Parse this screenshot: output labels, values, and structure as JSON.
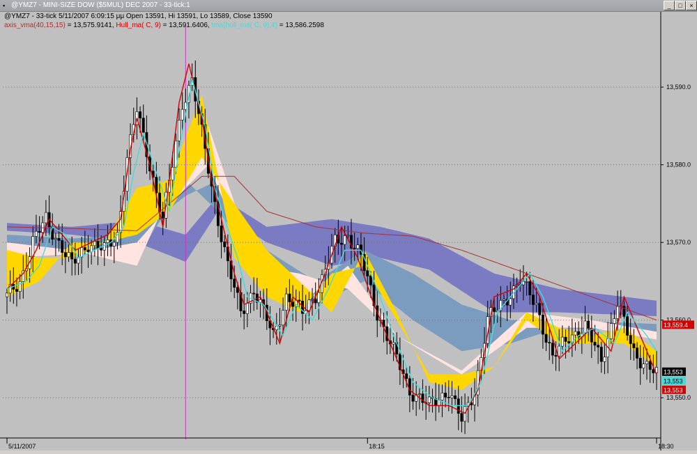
{
  "window": {
    "title": "@YMZ7 - MINI-SIZE DOW ($5MUL) DEC 2007 - 33-tick:1",
    "minimize_glyph": "_",
    "maximize_glyph": "□",
    "close_glyph": "×"
  },
  "info": {
    "line1": "@YMZ7 - 33-tick 5/11/2007 6:09:15 μμ Open 13591, Hi 13591, Lo 13589, Close 13590",
    "vma_label": "axis_vma(40,15,15)",
    "vma_value": "= 13,575.9141,",
    "hull_label": "Hull_ma( C, 9)",
    "hull_value": "= 13,591.6406,",
    "third_label": "tma(hull_ma( C, 9),4)",
    "third_value": "= 13,586.2598"
  },
  "colors": {
    "background": "#c0c0c0",
    "grid": "#707070",
    "gold": "#ffd700",
    "pink": "#ffe4e1",
    "steel": "#7c9cbf",
    "slate": "#7b7bc4",
    "hull": "#d40000",
    "trigger": "#3fdcdc",
    "vma": "#a83030",
    "cursor": "#cc33cc",
    "up_candle": "#ffffff",
    "down_candle": "#000000"
  },
  "chart_data": {
    "type": "candlestick",
    "ylim": [
      13545,
      13597
    ],
    "yticks": [
      13550,
      13560,
      13570,
      13580,
      13590
    ],
    "ytick_labels": [
      "13,550.0",
      "13,560.0",
      "13,570.0",
      "13,580.0",
      "13,590.0"
    ],
    "xtick_labels": [
      {
        "label": "5/11/2007",
        "index": 0
      },
      {
        "label": "18:15",
        "index": 111
      },
      {
        "label": "18:30",
        "index": 200
      }
    ],
    "price_tags": [
      {
        "label": "13,559.4",
        "value": 13559.4,
        "bg": "#d40000",
        "fg": "#ffffff"
      },
      {
        "label": "13,553",
        "value": 13553,
        "bg": "#000000",
        "fg": "#ffffff"
      },
      {
        "label": "13,553",
        "value": 13553,
        "bg": "#3fdcdc",
        "fg": "#000000"
      },
      {
        "label": "13,553",
        "value": 13553,
        "bg": "#d40000",
        "fg": "#ffffff"
      }
    ],
    "cursor_index": 55,
    "series": [
      {
        "name": "axis_vma(40,15,15)",
        "anchors": [
          [
            0,
            13572
          ],
          [
            20,
            13571.8
          ],
          [
            40,
            13571.5
          ],
          [
            50,
            13575
          ],
          [
            60,
            13578.5
          ],
          [
            70,
            13578.5
          ],
          [
            80,
            13574
          ],
          [
            95,
            13572
          ],
          [
            110,
            13571.2
          ],
          [
            125,
            13570.8
          ],
          [
            140,
            13569
          ],
          [
            160,
            13566
          ],
          [
            180,
            13563
          ],
          [
            200,
            13560
          ]
        ]
      },
      {
        "name": "Hull_ma( C, 9)",
        "anchors": [
          [
            0,
            13564
          ],
          [
            5,
            13566
          ],
          [
            9,
            13569
          ],
          [
            13,
            13573
          ],
          [
            17,
            13571
          ],
          [
            21,
            13569
          ],
          [
            26,
            13570
          ],
          [
            31,
            13571
          ],
          [
            35,
            13573
          ],
          [
            38,
            13582
          ],
          [
            40,
            13586
          ],
          [
            44,
            13580
          ],
          [
            48,
            13572
          ],
          [
            50,
            13578
          ],
          [
            53,
            13588
          ],
          [
            56,
            13593
          ],
          [
            60,
            13586
          ],
          [
            63,
            13578
          ],
          [
            66,
            13573
          ],
          [
            70,
            13566
          ],
          [
            73,
            13562
          ],
          [
            78,
            13563
          ],
          [
            84,
            13557
          ],
          [
            88,
            13563
          ],
          [
            93,
            13561
          ],
          [
            98,
            13566
          ],
          [
            103,
            13572
          ],
          [
            108,
            13568
          ],
          [
            113,
            13562
          ],
          [
            118,
            13557
          ],
          [
            124,
            13551
          ],
          [
            130,
            13549
          ],
          [
            136,
            13549
          ],
          [
            141,
            13548
          ],
          [
            145,
            13551
          ],
          [
            150,
            13563
          ],
          [
            156,
            13564
          ],
          [
            160,
            13566
          ],
          [
            164,
            13563
          ],
          [
            170,
            13555
          ],
          [
            175,
            13557
          ],
          [
            180,
            13559
          ],
          [
            186,
            13556
          ],
          [
            190,
            13563
          ],
          [
            196,
            13557
          ],
          [
            200,
            13553
          ]
        ]
      },
      {
        "name": "tma(hull_ma( C, 9),4)",
        "anchors": [
          [
            0,
            13564
          ],
          [
            6,
            13565
          ],
          [
            10,
            13567
          ],
          [
            14,
            13572
          ],
          [
            18,
            13571
          ],
          [
            22,
            13568
          ],
          [
            27,
            13569
          ],
          [
            32,
            13570
          ],
          [
            36,
            13572
          ],
          [
            39,
            13579
          ],
          [
            42,
            13584
          ],
          [
            46,
            13579
          ],
          [
            50,
            13574
          ],
          [
            53,
            13582
          ],
          [
            57,
            13591
          ],
          [
            61,
            13585
          ],
          [
            64,
            13577
          ],
          [
            67,
            13573
          ],
          [
            71,
            13568
          ],
          [
            74,
            13563
          ],
          [
            79,
            13562
          ],
          [
            85,
            13558
          ],
          [
            89,
            13562
          ],
          [
            94,
            13560
          ],
          [
            99,
            13564
          ],
          [
            104,
            13569
          ],
          [
            109,
            13569
          ],
          [
            114,
            13564
          ],
          [
            119,
            13558
          ],
          [
            125,
            13552
          ],
          [
            131,
            13550
          ],
          [
            137,
            13549
          ],
          [
            142,
            13549
          ],
          [
            146,
            13552
          ],
          [
            151,
            13561
          ],
          [
            157,
            13564
          ],
          [
            161,
            13566
          ],
          [
            165,
            13563
          ],
          [
            171,
            13556
          ],
          [
            176,
            13558
          ],
          [
            181,
            13559
          ],
          [
            187,
            13557
          ],
          [
            191,
            13561
          ],
          [
            197,
            13558
          ],
          [
            200,
            13556
          ]
        ]
      }
    ],
    "ribbons": [
      {
        "name": "slate",
        "color": "#7b7bc4",
        "upper": [
          [
            0,
            13572.5
          ],
          [
            20,
            13572
          ],
          [
            40,
            13572.8
          ],
          [
            55,
            13571
          ],
          [
            65,
            13576
          ],
          [
            80,
            13572
          ],
          [
            100,
            13573
          ],
          [
            115,
            13572
          ],
          [
            130,
            13570.5
          ],
          [
            150,
            13566
          ],
          [
            170,
            13564
          ],
          [
            200,
            13562.5
          ]
        ],
        "lower": [
          [
            0,
            13571.5
          ],
          [
            20,
            13571
          ],
          [
            40,
            13570
          ],
          [
            55,
            13567.5
          ],
          [
            65,
            13574
          ],
          [
            80,
            13570
          ],
          [
            100,
            13567
          ],
          [
            115,
            13568
          ],
          [
            130,
            13566.5
          ],
          [
            150,
            13561
          ],
          [
            170,
            13561
          ],
          [
            200,
            13560.5
          ]
        ]
      },
      {
        "name": "steel",
        "color": "#7c9cbf",
        "upper": [
          [
            0,
            13571
          ],
          [
            20,
            13570.5
          ],
          [
            40,
            13571
          ],
          [
            55,
            13576
          ],
          [
            65,
            13578
          ],
          [
            80,
            13569
          ],
          [
            95,
            13565
          ],
          [
            110,
            13569
          ],
          [
            125,
            13566
          ],
          [
            140,
            13562
          ],
          [
            155,
            13560
          ],
          [
            170,
            13560
          ],
          [
            200,
            13559.5
          ]
        ],
        "lower": [
          [
            0,
            13568
          ],
          [
            20,
            13569
          ],
          [
            40,
            13568
          ],
          [
            55,
            13578
          ],
          [
            65,
            13574
          ],
          [
            80,
            13566
          ],
          [
            95,
            13562
          ],
          [
            110,
            13565
          ],
          [
            125,
            13560
          ],
          [
            140,
            13556
          ],
          [
            155,
            13557
          ],
          [
            170,
            13559
          ],
          [
            200,
            13558.5
          ]
        ]
      },
      {
        "name": "pink",
        "color": "#ffe4e1",
        "upper": [
          [
            0,
            13570
          ],
          [
            20,
            13569
          ],
          [
            40,
            13567
          ],
          [
            55,
            13581
          ],
          [
            62,
            13585
          ],
          [
            75,
            13569
          ],
          [
            90,
            13562
          ],
          [
            105,
            13567
          ],
          [
            120,
            13558
          ],
          [
            140,
            13553.5
          ],
          [
            160,
            13561
          ],
          [
            180,
            13560
          ],
          [
            200,
            13558.5
          ]
        ],
        "lower": [
          [
            0,
            13568
          ],
          [
            20,
            13568.5
          ],
          [
            40,
            13570
          ],
          [
            55,
            13577
          ],
          [
            62,
            13580
          ],
          [
            75,
            13567
          ],
          [
            90,
            13566
          ],
          [
            105,
            13564
          ],
          [
            120,
            13558
          ],
          [
            140,
            13553
          ],
          [
            160,
            13559
          ],
          [
            180,
            13559
          ],
          [
            200,
            13557.5
          ]
        ]
      },
      {
        "name": "gold",
        "color": "#ffd700",
        "upper": [
          [
            0,
            13569
          ],
          [
            10,
            13568
          ],
          [
            20,
            13568
          ],
          [
            30,
            13570
          ],
          [
            40,
            13577
          ],
          [
            50,
            13578
          ],
          [
            60,
            13589
          ],
          [
            70,
            13568
          ],
          [
            80,
            13563
          ],
          [
            90,
            13561
          ],
          [
            100,
            13566
          ],
          [
            110,
            13567
          ],
          [
            120,
            13560
          ],
          [
            130,
            13553
          ],
          [
            140,
            13553
          ],
          [
            150,
            13554
          ],
          [
            160,
            13561
          ],
          [
            170,
            13559
          ],
          [
            180,
            13558
          ],
          [
            190,
            13559
          ],
          [
            200,
            13556
          ]
        ],
        "lower": [
          [
            0,
            13563
          ],
          [
            10,
            13565
          ],
          [
            20,
            13570
          ],
          [
            30,
            13570
          ],
          [
            40,
            13571
          ],
          [
            50,
            13574
          ],
          [
            60,
            13581
          ],
          [
            70,
            13575
          ],
          [
            80,
            13569
          ],
          [
            90,
            13565
          ],
          [
            100,
            13561
          ],
          [
            110,
            13569
          ],
          [
            120,
            13561
          ],
          [
            130,
            13552
          ],
          [
            140,
            13551
          ],
          [
            150,
            13554
          ],
          [
            160,
            13560
          ],
          [
            170,
            13557
          ],
          [
            180,
            13557
          ],
          [
            190,
            13557
          ],
          [
            200,
            13554
          ]
        ]
      }
    ],
    "price_path": [
      [
        0,
        13563
      ],
      [
        4,
        13565
      ],
      [
        8,
        13570
      ],
      [
        12,
        13573
      ],
      [
        16,
        13570
      ],
      [
        20,
        13567
      ],
      [
        25,
        13570
      ],
      [
        30,
        13569
      ],
      [
        34,
        13571
      ],
      [
        37,
        13581
      ],
      [
        40,
        13587
      ],
      [
        44,
        13580
      ],
      [
        48,
        13573
      ],
      [
        51,
        13580
      ],
      [
        54,
        13588
      ],
      [
        57,
        13591
      ],
      [
        60,
        13584
      ],
      [
        64,
        13575
      ],
      [
        68,
        13567
      ],
      [
        72,
        13561
      ],
      [
        76,
        13564
      ],
      [
        82,
        13558
      ],
      [
        86,
        13563
      ],
      [
        91,
        13561
      ],
      [
        96,
        13564
      ],
      [
        101,
        13570
      ],
      [
        105,
        13571
      ],
      [
        109,
        13568
      ],
      [
        114,
        13561
      ],
      [
        119,
        13556
      ],
      [
        124,
        13551
      ],
      [
        130,
        13549
      ],
      [
        136,
        13551
      ],
      [
        140,
        13547
      ],
      [
        144,
        13551
      ],
      [
        148,
        13560
      ],
      [
        154,
        13563
      ],
      [
        158,
        13565
      ],
      [
        163,
        13562
      ],
      [
        168,
        13555
      ],
      [
        173,
        13558
      ],
      [
        178,
        13559
      ],
      [
        183,
        13555
      ],
      [
        188,
        13562
      ],
      [
        193,
        13556
      ],
      [
        197,
        13554
      ],
      [
        200,
        13553
      ]
    ],
    "candle_count": 201
  }
}
